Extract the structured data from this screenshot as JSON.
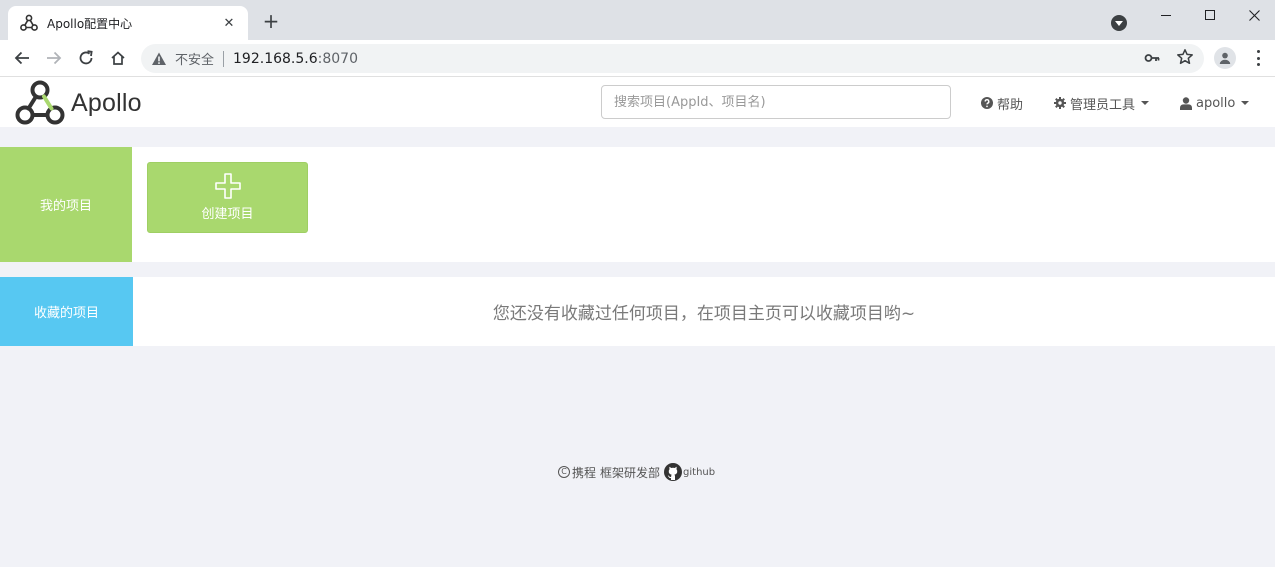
{
  "browser": {
    "tab_title": "Apollo配置中心",
    "security_label": "不安全",
    "url_host": "192.168.5.6",
    "url_port": ":8070"
  },
  "header": {
    "logo_text": "Apollo",
    "search_placeholder": "搜索项目(AppId、项目名)",
    "help_label": "帮助",
    "admin_tools_label": "管理员工具",
    "user_label": "apollo"
  },
  "my_projects": {
    "section_label": "我的项目",
    "create_label": "创建项目"
  },
  "favorites": {
    "section_label": "收藏的项目",
    "empty_message": "您还没有收藏过任何项目，在项目主页可以收藏项目哟~"
  },
  "footer": {
    "company": "携程",
    "department": "框架研发部",
    "github_label": "github"
  },
  "colors": {
    "my_projects_accent": "#a9d86e",
    "favorites_accent": "#57c8f2"
  }
}
